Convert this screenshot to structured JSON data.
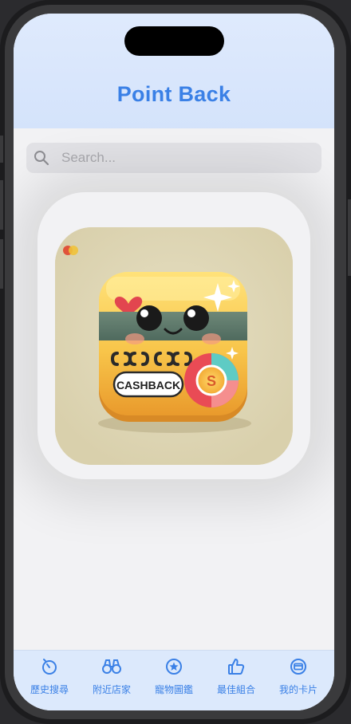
{
  "header": {
    "title": "Point Back"
  },
  "search": {
    "placeholder": "Search...",
    "value": ""
  },
  "app_icon": {
    "badge_text": "CASHBACK",
    "coin_symbol": "S"
  },
  "tabbar": {
    "items": [
      {
        "label": "歷史搜尋",
        "icon": "history-icon"
      },
      {
        "label": "附近店家",
        "icon": "binoculars-icon"
      },
      {
        "label": "寵物圖鑑",
        "icon": "star-circle-icon"
      },
      {
        "label": "最佳組合",
        "icon": "thumbs-up-icon"
      },
      {
        "label": "我的卡片",
        "icon": "credit-card-icon"
      }
    ]
  },
  "colors": {
    "accent": "#3a80e6",
    "header_bg": "#dfeafd",
    "tabbar_bg": "#dce9fc",
    "icon_bg": "#ddd4b1"
  }
}
